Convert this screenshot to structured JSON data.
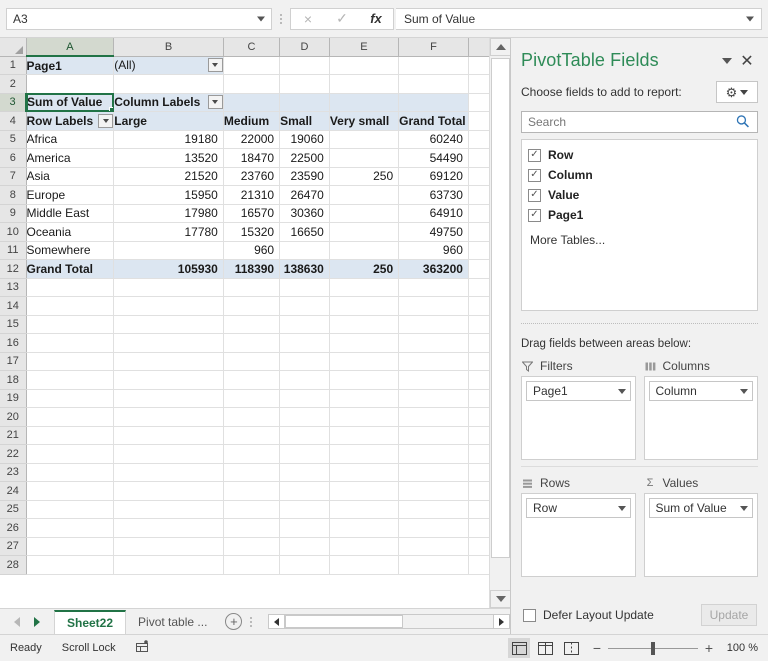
{
  "formula_bar": {
    "name_box_value": "A3",
    "cancel_label": "×",
    "enter_label": "✓",
    "fx_label": "fx",
    "formula_value": "Sum of Value"
  },
  "grid": {
    "column_headers": [
      "A",
      "B",
      "C",
      "D",
      "E",
      "F"
    ],
    "selected_column": "A",
    "selected_row": 3,
    "row_numbers": [
      1,
      2,
      3,
      4,
      5,
      6,
      7,
      8,
      9,
      10,
      11,
      12,
      13,
      14,
      15,
      16,
      17,
      18,
      19,
      20,
      21,
      22,
      23,
      24,
      25,
      26,
      27,
      28
    ],
    "page_filter": {
      "label": "Page1",
      "value": "(All)"
    },
    "pivot_corner": "Sum of Value",
    "column_labels_header": "Column Labels",
    "row_labels_header": "Row Labels",
    "column_headers_pivot": [
      "Large",
      "Medium",
      "Small",
      "Very small",
      "Grand Total"
    ],
    "rows": [
      {
        "label": "Africa",
        "values": [
          "19180",
          "22000",
          "19060",
          "",
          "60240"
        ]
      },
      {
        "label": "America",
        "values": [
          "13520",
          "18470",
          "22500",
          "",
          "54490"
        ]
      },
      {
        "label": "Asia",
        "values": [
          "21520",
          "23760",
          "23590",
          "250",
          "69120"
        ]
      },
      {
        "label": "Europe",
        "values": [
          "15950",
          "21310",
          "26470",
          "",
          "63730"
        ]
      },
      {
        "label": "Middle East",
        "values": [
          "17980",
          "16570",
          "30360",
          "",
          "64910"
        ]
      },
      {
        "label": "Oceania",
        "values": [
          "17780",
          "15320",
          "16650",
          "",
          "49750"
        ]
      },
      {
        "label": "Somewhere",
        "values": [
          "",
          "960",
          "",
          "",
          "960"
        ]
      }
    ],
    "grand_total": {
      "label": "Grand Total",
      "values": [
        "105930",
        "118390",
        "138630",
        "250",
        "363200"
      ]
    }
  },
  "tabbar": {
    "prev_label": "◄",
    "next_label": "►",
    "tabs": [
      {
        "name": "Sheet22",
        "active": true
      },
      {
        "name": "Pivot table  ...",
        "active": false
      }
    ],
    "add_sheet_label": "+"
  },
  "statusbar": {
    "mode": "Ready",
    "scroll_lock": "Scroll Lock",
    "macro_icon": "record-macro-icon",
    "zoom_out": "−",
    "zoom_in": "+",
    "zoom_value": "100 %"
  },
  "panel": {
    "title": "PivotTable Fields",
    "dropdown_icon": "chevron-down-icon",
    "close_icon": "✕",
    "choose_label": "Choose fields to add to report:",
    "gear_icon": "⚙",
    "search_placeholder": "Search",
    "search_value": "",
    "search_icon": "search-icon",
    "fields": [
      {
        "name": "Row",
        "checked": true
      },
      {
        "name": "Column",
        "checked": true
      },
      {
        "name": "Value",
        "checked": true
      },
      {
        "name": "Page1",
        "checked": true
      }
    ],
    "more_tables": "More Tables...",
    "check_glyph": "✓",
    "drag_hint": "Drag fields between areas below:",
    "areas": [
      {
        "key": "filters",
        "label": "Filters",
        "icon": "filter-icon",
        "icon_glyph": "▽",
        "chip": "Page1"
      },
      {
        "key": "columns",
        "label": "Columns",
        "icon": "columns-icon",
        "icon_glyph": "▐▐",
        "chip": "Column"
      },
      {
        "key": "rows",
        "label": "Rows",
        "icon": "rows-icon",
        "icon_glyph": "≡",
        "chip": "Row"
      },
      {
        "key": "values",
        "label": "Values",
        "icon": "sigma-icon",
        "icon_glyph": "Σ",
        "chip": "Sum of Value"
      }
    ],
    "defer_label": "Defer Layout Update",
    "update_label": "Update"
  },
  "colors": {
    "excel_green": "#217346",
    "panel_title_green": "#2e8b57",
    "pivot_header_blue": "#dce6f1"
  }
}
